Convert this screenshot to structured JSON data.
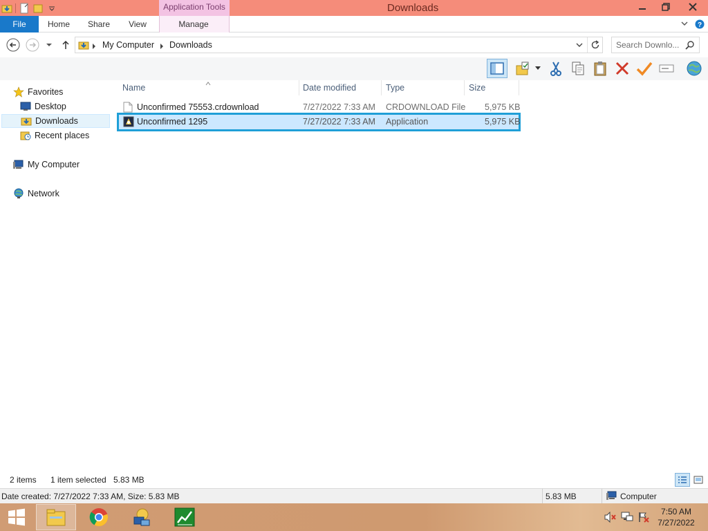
{
  "window": {
    "title": "Downloads",
    "context_tab": "Application Tools"
  },
  "ribbon": {
    "tabs": [
      "File",
      "Home",
      "Share",
      "View",
      "Manage"
    ]
  },
  "address": {
    "crumbs": [
      "My Computer",
      "Downloads"
    ],
    "search_placeholder": "Search Downlo..."
  },
  "navpane": {
    "favorites": "Favorites",
    "desktop": "Desktop",
    "downloads": "Downloads",
    "recent": "Recent places",
    "my_computer": "My Computer",
    "network": "Network"
  },
  "filelist": {
    "columns": [
      "Name",
      "Date modified",
      "Type",
      "Size"
    ],
    "rows": [
      {
        "name": "Unconfirmed 75553.crdownload",
        "date": "7/27/2022 7:33 AM",
        "type": "CRDOWNLOAD File",
        "size": "5,975 KB"
      },
      {
        "name": "Unconfirmed 1295",
        "date": "7/27/2022 7:33 AM",
        "type": "Application",
        "size": "5,975 KB"
      }
    ]
  },
  "status": {
    "items": "2 items",
    "selected": "1 item selected",
    "selected_size": "5.83 MB"
  },
  "details": {
    "info": "Date created: 7/27/2022 7:33 AM, Size: 5.83 MB",
    "size": "5.83 MB",
    "location": "Computer"
  },
  "taskbar": {
    "time": "7:50 AM",
    "date": "7/27/2022"
  },
  "colors": {
    "titlebar": "#f58c7a",
    "file_tab": "#1979ca",
    "selection": "#cce8ff",
    "selection_outline": "#1f9fd7"
  }
}
